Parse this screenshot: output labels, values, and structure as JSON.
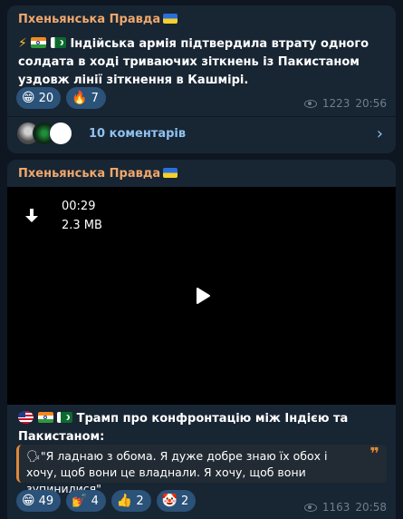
{
  "posts": [
    {
      "channel": "Пхеньянська Правда",
      "text": "Індійська армія підтвердила втрату одного солдата в ході триваючих зіткнень із Пакистаном уздовж лінії зіткнення в Кашмірі.",
      "reactions": [
        {
          "emoji": "😁",
          "count": "20"
        },
        {
          "emoji": "🔥",
          "count": "7"
        }
      ],
      "views": "1223",
      "time": "20:56",
      "comments_label": "10 коментарів"
    },
    {
      "channel": "Пхеньянська Правда",
      "video": {
        "duration": "00:29",
        "size": "2.3 MB"
      },
      "text": "Трамп про конфронтацію між Індією та Пакистаном:",
      "quote": "\"Я ладнаю з обома. Я дуже добре знаю їх обох і хочу, щоб вони це владнали. Я хочу, щоб вони зупинилися\"",
      "reactions": [
        {
          "emoji": "😁",
          "count": "49"
        },
        {
          "emoji": "💅",
          "count": "4"
        },
        {
          "emoji": "👍",
          "count": "2"
        },
        {
          "emoji": "🤡",
          "count": "2"
        }
      ],
      "views": "1163",
      "time": "20:58"
    }
  ],
  "colors": {
    "background": "#0e1621",
    "bubble": "#182533",
    "channel_name": "#f0a86c",
    "reaction_pill": "#2b5278",
    "link": "#8fc2f0",
    "meta": "#6d7f8f"
  },
  "icons": [
    "lightning-icon",
    "flag-india-icon",
    "flag-pakistan-icon",
    "flag-ukraine-icon",
    "flag-usa-icon",
    "eye-icon",
    "chevron-right-icon",
    "download-icon",
    "play-icon",
    "speech-bubble-icon",
    "quote-mark-icon"
  ]
}
